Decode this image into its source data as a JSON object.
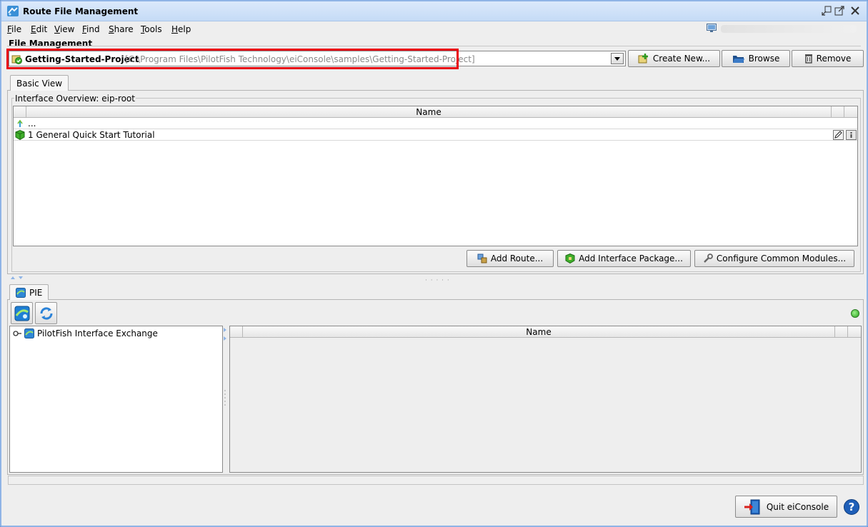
{
  "window": {
    "title": "Route File Management"
  },
  "menu": [
    {
      "label": "File",
      "mn": "F",
      "rest": "ile"
    },
    {
      "label": "Edit",
      "mn": "E",
      "rest": "dit"
    },
    {
      "label": "View",
      "mn": "V",
      "rest": "iew"
    },
    {
      "label": "Find",
      "mn": "F",
      "rest": "ind"
    },
    {
      "label": "Share",
      "mn": "S",
      "rest": "hare"
    },
    {
      "label": "Tools",
      "mn": "T",
      "rest": "ools"
    },
    {
      "label": "Help",
      "mn": "H",
      "rest": "elp"
    }
  ],
  "file_management": {
    "label": "File Management",
    "project_name": "Getting-Started-Project",
    "project_path": "[C:\\Program Files\\PilotFish Technology\\eiConsole\\samples\\Getting-Started-Project]",
    "create_new": "Create New...",
    "browse": "Browse",
    "remove": "Remove"
  },
  "basic_view": {
    "tab": "Basic View",
    "group_title": "Interface Overview: eip-root",
    "column_name": "Name",
    "rows": [
      {
        "label": "..."
      },
      {
        "label": "1 General Quick Start Tutorial"
      }
    ],
    "add_route": "Add Route...",
    "add_interface_package": "Add Interface Package...",
    "configure_common_modules": "Configure Common Modules..."
  },
  "pie": {
    "tab": "PIE",
    "tree_root": "PilotFish Interface Exchange",
    "column_name": "Name"
  },
  "footer": {
    "quit": "Quit eiConsole",
    "help": "?"
  },
  "colors": {
    "highlight": "#e8000d",
    "status_ok": "#27a31b"
  }
}
